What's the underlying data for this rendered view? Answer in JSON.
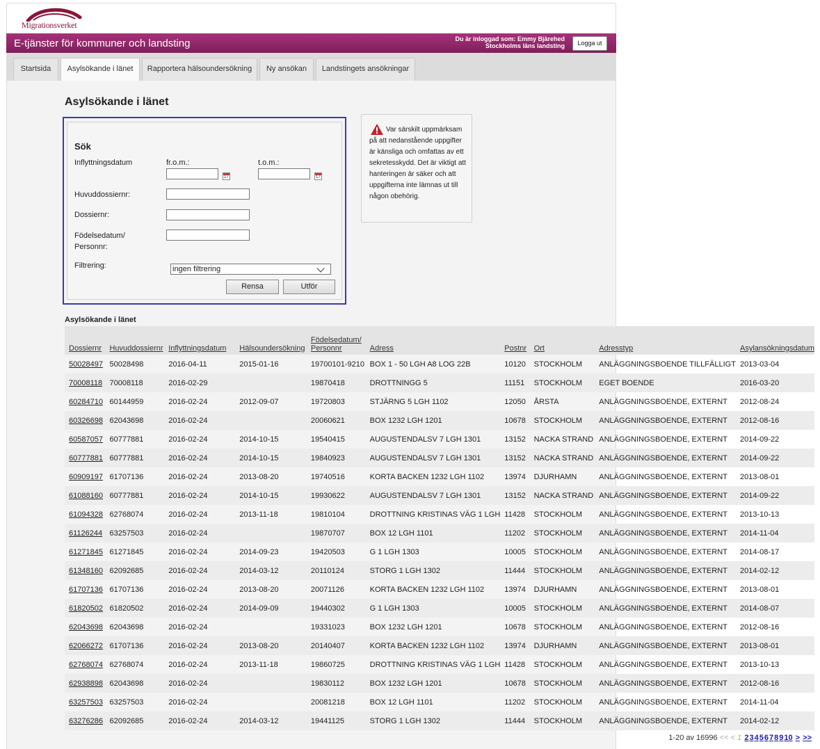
{
  "brand": {
    "logo_text": "Migrationsverket",
    "color": "#8a1538"
  },
  "header": {
    "title": "E-tjänster för kommuner och landsting",
    "user_label": "Du är inloggad som: Emmy Bjärehed",
    "user_org": "Stockholms läns landsting",
    "logout_label": "Logga ut",
    "banner_color": "#8e2768"
  },
  "tabs": [
    {
      "label": "Startsida",
      "active": false
    },
    {
      "label": "Asylsökande i länet",
      "active": true
    },
    {
      "label": "Rapportera hälsoundersökning",
      "active": false
    },
    {
      "label": "Ny ansökan",
      "active": false
    },
    {
      "label": "Landstingets ansökningar",
      "active": false
    }
  ],
  "page": {
    "title": "Asylsökande i länet"
  },
  "search": {
    "heading": "Sök",
    "inflyttning_label": "Inflyttningsdatum",
    "from_label": "fr.o.m.:",
    "to_label": "t.o.m.:",
    "from_value": "",
    "to_value": "",
    "calendar_day": "17",
    "huvuddossier_label": "Huvuddossiernr:",
    "huvuddossier_value": "",
    "dossier_label": "Dossiernr:",
    "dossier_value": "",
    "fodelse_label_1": "Födelsedatum/",
    "fodelse_label_2": "Personnr:",
    "fodelse_value": "",
    "filter_label": "Filtrering:",
    "filter_value": "ingen filtrering",
    "reset_label": "Rensa",
    "submit_label": "Utför"
  },
  "warning": {
    "text": "Var särskilt uppmärksam på att nedanstående uppgifter är känsliga och omfattas av ett sekretesskydd. Det är viktigt att hanteringen är säker och att uppgifterna inte lämnas ut till någon obehörig."
  },
  "results": {
    "title": "Asylsökande i länet",
    "columns": [
      "Dossiernr",
      "Huvuddossiernr",
      "Inflyttningsdatum",
      "Hälsoundersökning",
      "Födelsedatum/",
      "Adress",
      "Postnr",
      "Ort",
      "Adresstyp",
      "Asylansökningsdatum"
    ],
    "column_birth_line2": "Personnr",
    "rows": [
      [
        "50028497",
        "50028498",
        "2016-04-11",
        "2015-01-16",
        "19700101-9210",
        "BOX 1 - 50 LGH A8 LOG 22B",
        "10120",
        "STOCKHOLM",
        "ANLÄGGNINGSBOENDE TILLFÄLLIGT",
        "2013-03-04"
      ],
      [
        "70008118",
        "70008118",
        "2016-02-29",
        "",
        "19870418",
        "DROTTNINGG 5",
        "11151",
        "STOCKHOLM",
        "EGET BOENDE",
        "2016-03-20"
      ],
      [
        "60284710",
        "60144959",
        "2016-02-24",
        "2012-09-07",
        "19720803",
        "STJÄRNG 5 LGH 1102",
        "12050",
        "ÅRSTA",
        "ANLÄGGNINGSBOENDE, EXTERNT",
        "2012-08-24"
      ],
      [
        "60326698",
        "62043698",
        "2016-02-24",
        "",
        "20060621",
        "BOX 1232 LGH 1201",
        "10678",
        "STOCKHOLM",
        "ANLÄGGNINGSBOENDE, EXTERNT",
        "2012-08-16"
      ],
      [
        "60587057",
        "60777881",
        "2016-02-24",
        "2014-10-15",
        "19540415",
        "AUGUSTENDALSV 7 LGH 1301",
        "13152",
        "NACKA STRAND",
        "ANLÄGGNINGSBOENDE, EXTERNT",
        "2014-09-22"
      ],
      [
        "60777881",
        "60777881",
        "2016-02-24",
        "2014-10-15",
        "19840923",
        "AUGUSTENDALSV 7 LGH 1301",
        "13152",
        "NACKA STRAND",
        "ANLÄGGNINGSBOENDE, EXTERNT",
        "2014-09-22"
      ],
      [
        "60909197",
        "61707136",
        "2016-02-24",
        "2013-08-20",
        "19740516",
        "KORTA BACKEN 1232 LGH 1102",
        "13974",
        "DJURHAMN",
        "ANLÄGGNINGSBOENDE, EXTERNT",
        "2013-08-01"
      ],
      [
        "61088160",
        "60777881",
        "2016-02-24",
        "2014-10-15",
        "19930622",
        "AUGUSTENDALSV 7 LGH 1301",
        "13152",
        "NACKA STRAND",
        "ANLÄGGNINGSBOENDE, EXTERNT",
        "2014-09-22"
      ],
      [
        "61094328",
        "62768074",
        "2016-02-24",
        "2013-11-18",
        "19810104",
        "DROTTNING KRISTINAS VÄG 1 LGH",
        "11428",
        "STOCKHOLM",
        "ANLÄGGNINGSBOENDE, EXTERNT",
        "2013-10-13"
      ],
      [
        "61126244",
        "63257503",
        "2016-02-24",
        "",
        "19870707",
        "BOX 12 LGH 1101",
        "11202",
        "STOCKHOLM",
        "ANLÄGGNINGSBOENDE, EXTERNT",
        "2014-11-04"
      ],
      [
        "61271845",
        "61271845",
        "2016-02-24",
        "2014-09-23",
        "19420503",
        "G 1 LGH 1303",
        "10005",
        "STOCKHOLM",
        "ANLÄGGNINGSBOENDE, EXTERNT",
        "2014-08-17"
      ],
      [
        "61348160",
        "62092685",
        "2016-02-24",
        "2014-03-12",
        "20110124",
        "STORG 1 LGH 1302",
        "11444",
        "STOCKHOLM",
        "ANLÄGGNINGSBOENDE, EXTERNT",
        "2014-02-12"
      ],
      [
        "61707136",
        "61707136",
        "2016-02-24",
        "2013-08-20",
        "20071126",
        "KORTA BACKEN 1232 LGH 1102",
        "13974",
        "DJURHAMN",
        "ANLÄGGNINGSBOENDE, EXTERNT",
        "2013-08-01"
      ],
      [
        "61820502",
        "61820502",
        "2016-02-24",
        "2014-09-09",
        "19440302",
        "G 1 LGH 1303",
        "10005",
        "STOCKHOLM",
        "ANLÄGGNINGSBOENDE, EXTERNT",
        "2014-08-07"
      ],
      [
        "62043698",
        "62043698",
        "2016-02-24",
        "",
        "19331023",
        "BOX 1232 LGH 1201",
        "10678",
        "STOCKHOLM",
        "ANLÄGGNINGSBOENDE, EXTERNT",
        "2012-08-16"
      ],
      [
        "62066272",
        "61707136",
        "2016-02-24",
        "2013-08-20",
        "20140407",
        "KORTA BACKEN 1232 LGH 1102",
        "13974",
        "DJURHAMN",
        "ANLÄGGNINGSBOENDE, EXTERNT",
        "2013-08-01"
      ],
      [
        "62768074",
        "62768074",
        "2016-02-24",
        "2013-11-18",
        "19860725",
        "DROTTNING KRISTINAS VÄG 1 LGH",
        "11428",
        "STOCKHOLM",
        "ANLÄGGNINGSBOENDE, EXTERNT",
        "2013-10-13"
      ],
      [
        "62938898",
        "62043698",
        "2016-02-24",
        "",
        "19830112",
        "BOX 1232 LGH 1201",
        "10678",
        "STOCKHOLM",
        "ANLÄGGNINGSBOENDE, EXTERNT",
        "2012-08-16"
      ],
      [
        "63257503",
        "63257503",
        "2016-02-24",
        "",
        "20081218",
        "BOX 12 LGH 1101",
        "11202",
        "STOCKHOLM",
        "ANLÄGGNINGSBOENDE, EXTERNT",
        "2014-11-04"
      ],
      [
        "63276286",
        "62092685",
        "2016-02-24",
        "2014-03-12",
        "19441125",
        "STORG 1 LGH 1302",
        "11444",
        "STOCKHOLM",
        "ANLÄGGNINGSBOENDE, EXTERNT",
        "2014-02-12"
      ]
    ]
  },
  "pager": {
    "range": "1-20 av 16996",
    "first": "<<",
    "prev": "<",
    "current": "1",
    "pages": [
      "2",
      "3",
      "4",
      "5",
      "6",
      "7",
      "8",
      "9",
      "10"
    ],
    "next": ">",
    "last": ">>"
  }
}
